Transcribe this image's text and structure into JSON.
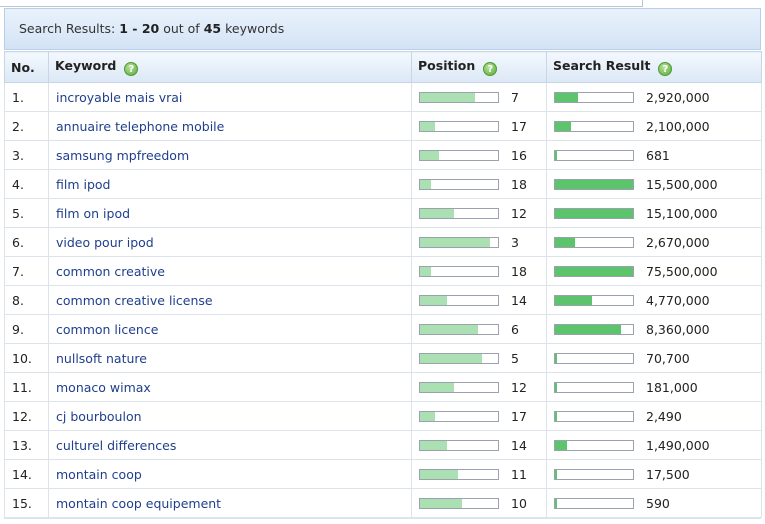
{
  "header": {
    "prefix": "Search Results:",
    "range": "1 - 20",
    "mid": "out of",
    "total": "45",
    "suffix": "keywords"
  },
  "columns": {
    "no": "No.",
    "keyword": "Keyword",
    "position": "Position",
    "search_result": "Search Result",
    "help_icon": "help-icon"
  },
  "colors": {
    "position_bar": "#abe0b2",
    "search_bar": "#5cc46b",
    "link": "#1f3f8c"
  },
  "rows": [
    {
      "no": "1.",
      "keyword": "incroyable mais vrai",
      "position": "7",
      "position_fill": 0.7,
      "search": "2,920,000",
      "search_fill": 0.29
    },
    {
      "no": "2.",
      "keyword": "annuaire telephone mobile",
      "position": "17",
      "position_fill": 0.19,
      "search": "2,100,000",
      "search_fill": 0.21
    },
    {
      "no": "3.",
      "keyword": "samsung mpfreedom",
      "position": "16",
      "position_fill": 0.24,
      "search": "681",
      "search_fill": 0.02
    },
    {
      "no": "4.",
      "keyword": "film ipod",
      "position": "18",
      "position_fill": 0.14,
      "search": "15,500,000",
      "search_fill": 1.0
    },
    {
      "no": "5.",
      "keyword": "film on ipod",
      "position": "12",
      "position_fill": 0.44,
      "search": "15,100,000",
      "search_fill": 1.0
    },
    {
      "no": "6.",
      "keyword": "video pour ipod",
      "position": "3",
      "position_fill": 0.9,
      "search": "2,670,000",
      "search_fill": 0.26
    },
    {
      "no": "7.",
      "keyword": "common creative",
      "position": "18",
      "position_fill": 0.14,
      "search": "75,500,000",
      "search_fill": 1.0
    },
    {
      "no": "8.",
      "keyword": "common creative license",
      "position": "14",
      "position_fill": 0.34,
      "search": "4,770,000",
      "search_fill": 0.47
    },
    {
      "no": "9.",
      "keyword": "common licence",
      "position": "6",
      "position_fill": 0.74,
      "search": "8,360,000",
      "search_fill": 0.84
    },
    {
      "no": "10.",
      "keyword": "nullsoft nature",
      "position": "5",
      "position_fill": 0.8,
      "search": "70,700",
      "search_fill": 0.02
    },
    {
      "no": "11.",
      "keyword": "monaco wimax",
      "position": "12",
      "position_fill": 0.44,
      "search": "181,000",
      "search_fill": 0.02
    },
    {
      "no": "12.",
      "keyword": "cj bourboulon",
      "position": "17",
      "position_fill": 0.19,
      "search": "2,490",
      "search_fill": 0.02
    },
    {
      "no": "13.",
      "keyword": "culturel differences",
      "position": "14",
      "position_fill": 0.34,
      "search": "1,490,000",
      "search_fill": 0.15
    },
    {
      "no": "14.",
      "keyword": "montain coop",
      "position": "11",
      "position_fill": 0.49,
      "search": "17,500",
      "search_fill": 0.02
    },
    {
      "no": "15.",
      "keyword": "montain coop equipement",
      "position": "10",
      "position_fill": 0.54,
      "search": "590",
      "search_fill": 0.02
    }
  ]
}
